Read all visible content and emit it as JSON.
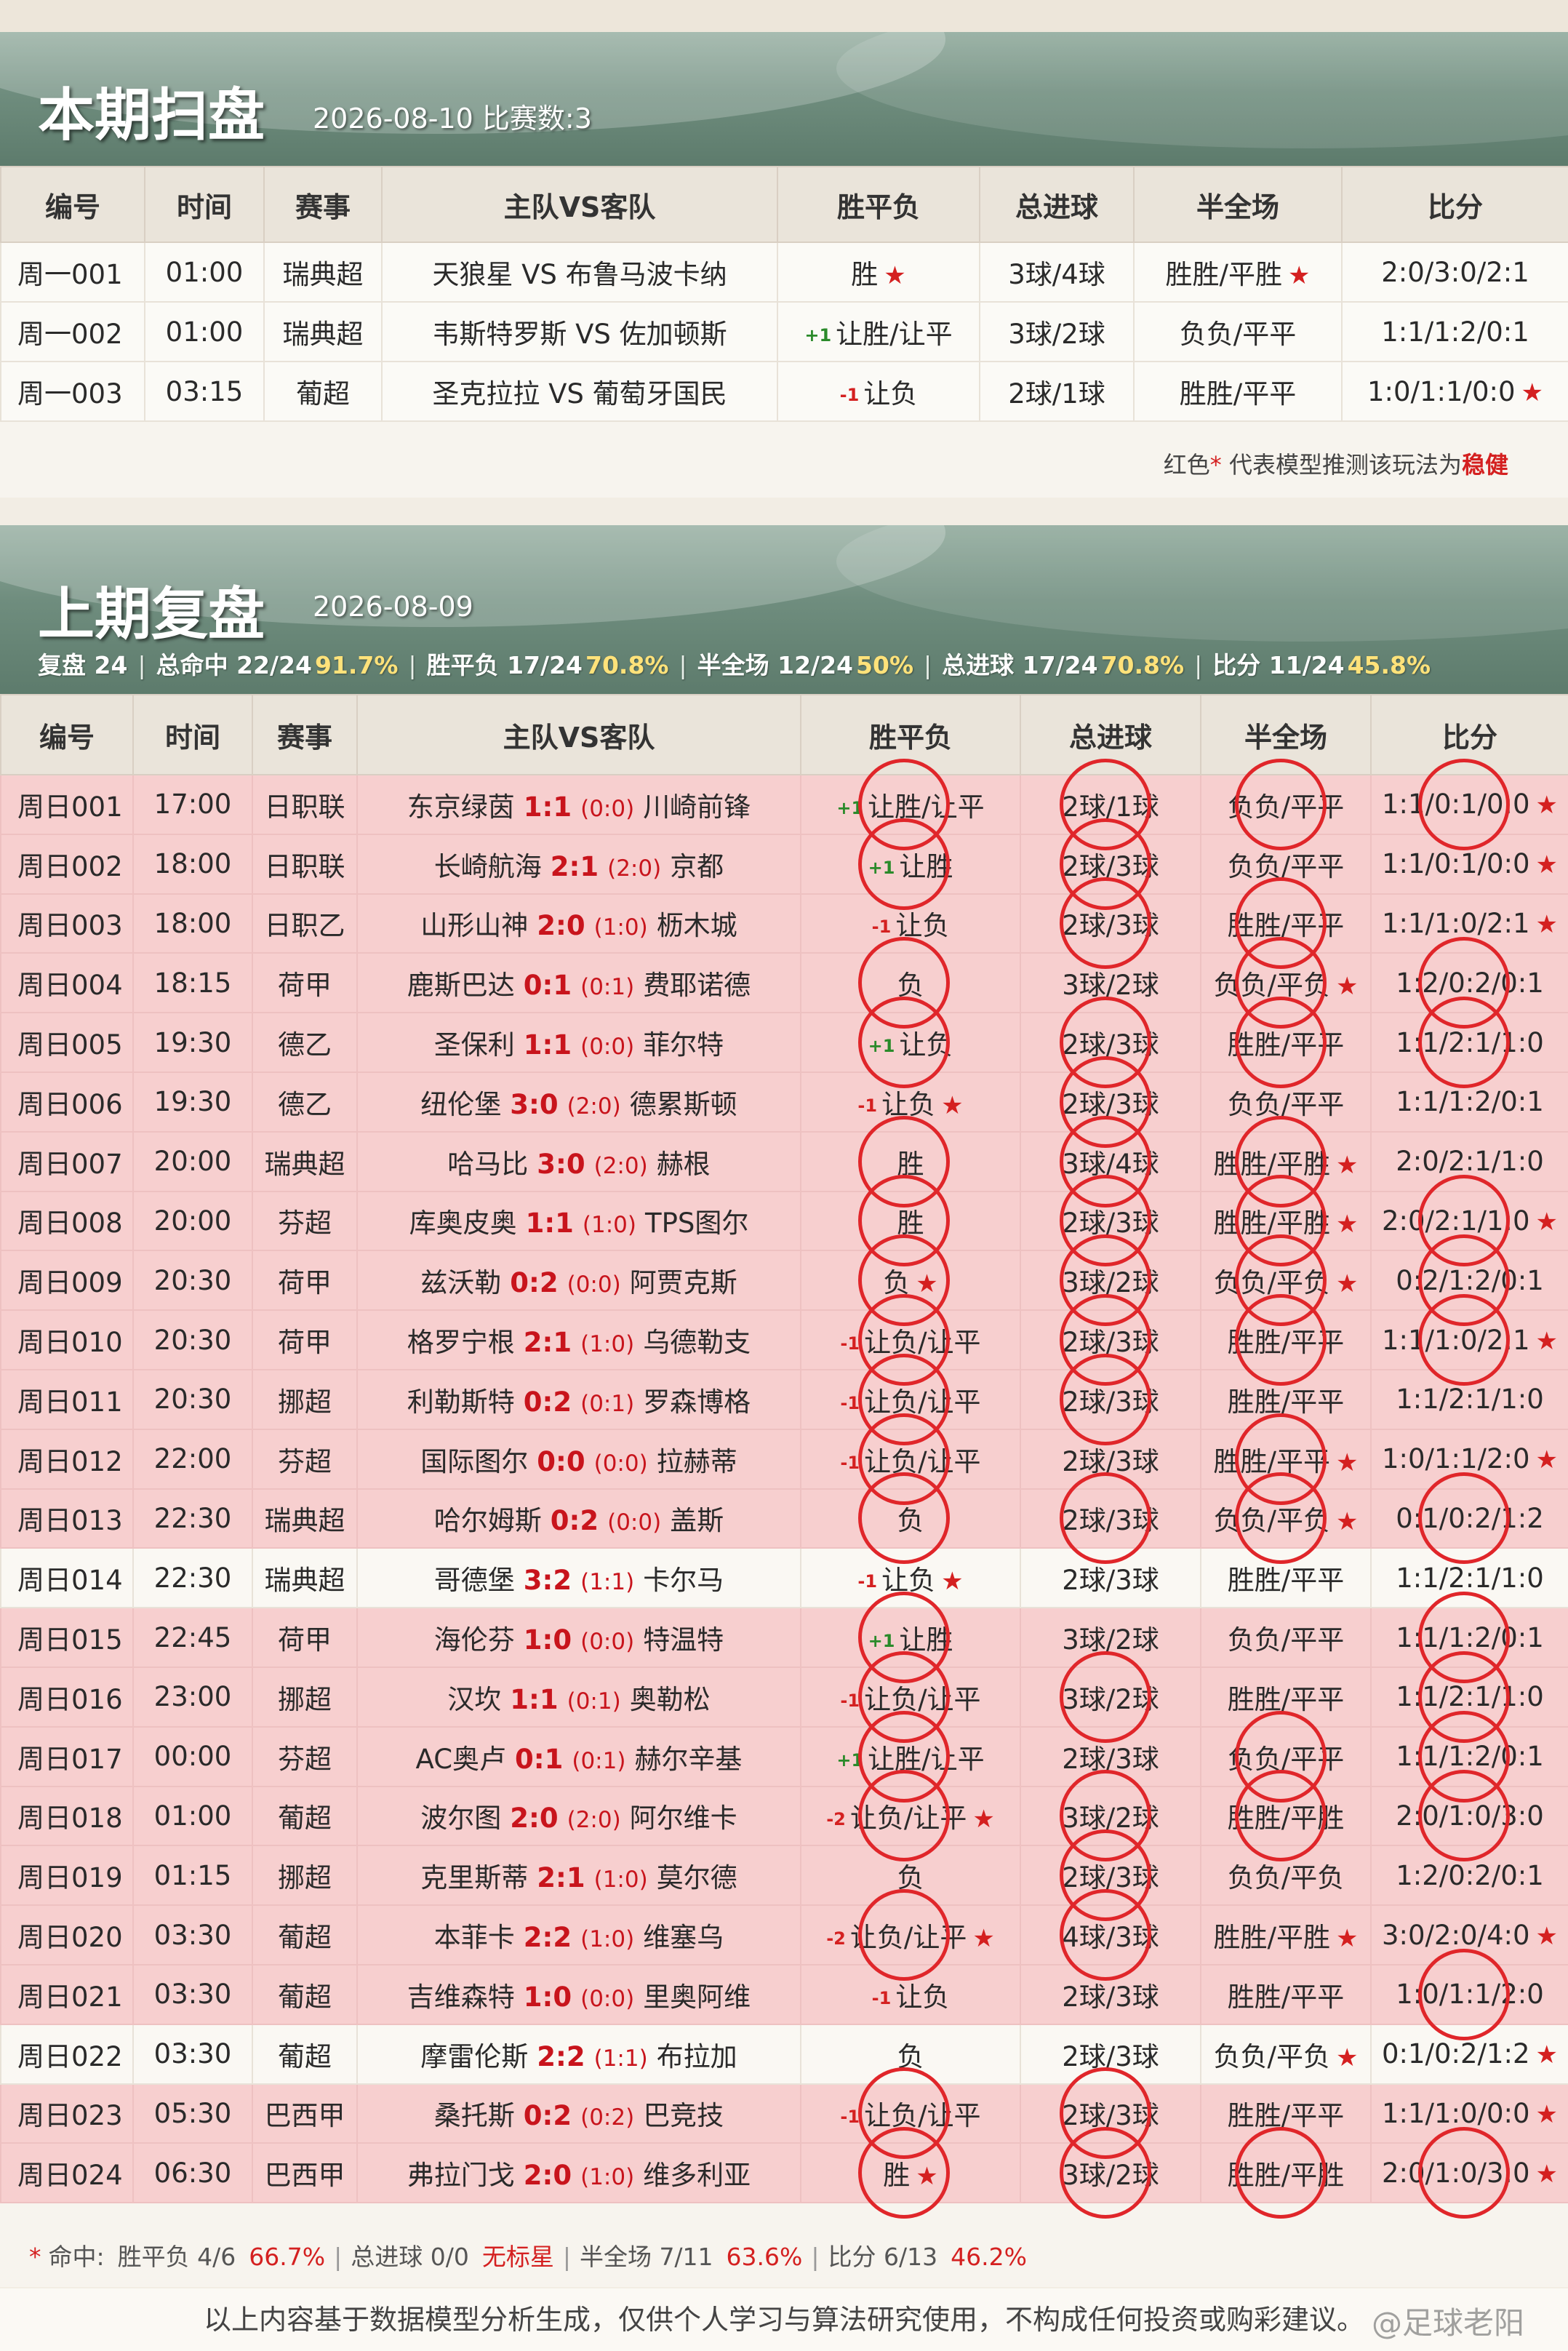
{
  "current": {
    "title": "本期扫盘",
    "subtitle": "2026-08-10 比赛数:3",
    "headers": [
      "编号",
      "时间",
      "赛事",
      "主队VS客队",
      "胜平负",
      "总进球",
      "半全场",
      "比分"
    ],
    "rows": [
      {
        "no": "周一001",
        "time": "01:00",
        "league": "瑞典超",
        "match": "天狼星 VS 布鲁马波卡纳",
        "hc": "",
        "hcClass": "",
        "spf": "胜",
        "spfStar": "★",
        "total": "3球/4球",
        "totalStar": "",
        "bqc": "胜胜/平胜",
        "bqcStar": "★",
        "score": "2:0/3:0/2:1",
        "scoreStar": ""
      },
      {
        "no": "周一002",
        "time": "01:00",
        "league": "瑞典超",
        "match": "韦斯特罗斯 VS 佐加顿斯",
        "hc": "+1",
        "hcClass": "pos",
        "spf": "让胜/让平",
        "spfStar": "",
        "total": "3球/2球",
        "totalStar": "",
        "bqc": "负负/平平",
        "bqcStar": "",
        "score": "1:1/1:2/0:1",
        "scoreStar": ""
      },
      {
        "no": "周一003",
        "time": "03:15",
        "league": "葡超",
        "match": "圣克拉拉 VS 葡萄牙国民",
        "hc": "-1",
        "hcClass": "neg",
        "spf": "让负",
        "spfStar": "",
        "total": "2球/1球",
        "totalStar": "",
        "bqc": "胜胜/平平",
        "bqcStar": "",
        "score": "1:0/1:1/0:0",
        "scoreStar": "★"
      }
    ],
    "note": {
      "pre": "红色",
      "star": "*",
      "mid": " 代表模型推测该玩法为",
      "key": "稳健"
    }
  },
  "previous": {
    "title": "上期复盘",
    "subtitle": "2026-08-09",
    "stats": [
      {
        "label": "复盘 ",
        "value": "24",
        "pct": ""
      },
      {
        "label": "总命中 ",
        "value": "22/24",
        "pct": "91.7%"
      },
      {
        "label": "胜平负 ",
        "value": "17/24",
        "pct": "70.8%"
      },
      {
        "label": "半全场 ",
        "value": "12/24",
        "pct": "50%"
      },
      {
        "label": "总进球 ",
        "value": "17/24",
        "pct": "70.8%"
      },
      {
        "label": "比分 ",
        "value": "11/24",
        "pct": "45.8%"
      }
    ],
    "headers": [
      "编号",
      "时间",
      "赛事",
      "主队VS客队",
      "胜平负",
      "总进球",
      "半全场",
      "比分"
    ],
    "rows": [
      {
        "no": "周日001",
        "time": "17:00",
        "league": "日职联",
        "home": "东京绿茵",
        "score": "1:1",
        "half": "(0:0)",
        "away": "川崎前锋",
        "hc": "+1",
        "hcClass": "pos",
        "spf": "让胜/让平",
        "spfStar": "",
        "total": "2球/1球",
        "totalStar": "",
        "bqc": "负负/平平",
        "bqcStar": "",
        "cs": "1:1/0:1/0:0",
        "csStar": "★",
        "hit": true,
        "circles": [
          1,
          1,
          1,
          1
        ]
      },
      {
        "no": "周日002",
        "time": "18:00",
        "league": "日职联",
        "home": "长崎航海",
        "score": "2:1",
        "half": "(2:0)",
        "away": "京都",
        "hc": "+1",
        "hcClass": "pos",
        "spf": "让胜",
        "spfStar": "",
        "total": "2球/3球",
        "totalStar": "",
        "bqc": "负负/平平",
        "bqcStar": "",
        "cs": "1:1/0:1/0:0",
        "csStar": "★",
        "hit": true,
        "circles": [
          1,
          1,
          0,
          0
        ]
      },
      {
        "no": "周日003",
        "time": "18:00",
        "league": "日职乙",
        "home": "山形山神",
        "score": "2:0",
        "half": "(1:0)",
        "away": "枥木城",
        "hc": "-1",
        "hcClass": "neg",
        "spf": "让负",
        "spfStar": "",
        "total": "2球/3球",
        "totalStar": "",
        "bqc": "胜胜/平平",
        "bqcStar": "",
        "cs": "1:1/1:0/2:1",
        "csStar": "★",
        "hit": true,
        "circles": [
          0,
          1,
          1,
          0
        ]
      },
      {
        "no": "周日004",
        "time": "18:15",
        "league": "荷甲",
        "home": "鹿斯巴达",
        "score": "0:1",
        "half": "(0:1)",
        "away": "费耶诺德",
        "hc": "",
        "hcClass": "",
        "spf": "负",
        "spfStar": "",
        "total": "3球/2球",
        "totalStar": "",
        "bqc": "负负/平负",
        "bqcStar": "★",
        "cs": "1:2/0:2/0:1",
        "csStar": "",
        "hit": true,
        "circles": [
          1,
          0,
          1,
          1
        ]
      },
      {
        "no": "周日005",
        "time": "19:30",
        "league": "德乙",
        "home": "圣保利",
        "score": "1:1",
        "half": "(0:0)",
        "away": "菲尔特",
        "hc": "+1",
        "hcClass": "pos",
        "spf": "让负",
        "spfStar": "",
        "total": "2球/3球",
        "totalStar": "",
        "bqc": "胜胜/平平",
        "bqcStar": "",
        "cs": "1:1/2:1/1:0",
        "csStar": "",
        "hit": true,
        "circles": [
          1,
          1,
          1,
          1
        ]
      },
      {
        "no": "周日006",
        "time": "19:30",
        "league": "德乙",
        "home": "纽伦堡",
        "score": "3:0",
        "half": "(2:0)",
        "away": "德累斯顿",
        "hc": "-1",
        "hcClass": "neg",
        "spf": "让负",
        "spfStar": "★",
        "total": "2球/3球",
        "totalStar": "",
        "bqc": "负负/平平",
        "bqcStar": "",
        "cs": "1:1/1:2/0:1",
        "csStar": "",
        "hit": true,
        "circles": [
          0,
          1,
          0,
          0
        ]
      },
      {
        "no": "周日007",
        "time": "20:00",
        "league": "瑞典超",
        "home": "哈马比",
        "score": "3:0",
        "half": "(2:0)",
        "away": "赫根",
        "hc": "",
        "hcClass": "",
        "spf": "胜",
        "spfStar": "",
        "total": "3球/4球",
        "totalStar": "",
        "bqc": "胜胜/平胜",
        "bqcStar": "★",
        "cs": "2:0/2:1/1:0",
        "csStar": "",
        "hit": true,
        "circles": [
          1,
          1,
          1,
          0
        ]
      },
      {
        "no": "周日008",
        "time": "20:00",
        "league": "芬超",
        "home": "库奥皮奥",
        "score": "1:1",
        "half": "(1:0)",
        "away": "TPS图尔",
        "hc": "",
        "hcClass": "",
        "spf": "胜",
        "spfStar": "",
        "total": "2球/3球",
        "totalStar": "",
        "bqc": "胜胜/平胜",
        "bqcStar": "★",
        "cs": "2:0/2:1/1:0",
        "csStar": "★",
        "hit": true,
        "circles": [
          1,
          1,
          1,
          1
        ]
      },
      {
        "no": "周日009",
        "time": "20:30",
        "league": "荷甲",
        "home": "兹沃勒",
        "score": "0:2",
        "half": "(0:0)",
        "away": "阿贾克斯",
        "hc": "",
        "hcClass": "",
        "spf": "负",
        "spfStar": "★",
        "total": "3球/2球",
        "totalStar": "",
        "bqc": "负负/平负",
        "bqcStar": "★",
        "cs": "0:2/1:2/0:1",
        "csStar": "",
        "hit": true,
        "circles": [
          1,
          1,
          1,
          1
        ]
      },
      {
        "no": "周日010",
        "time": "20:30",
        "league": "荷甲",
        "home": "格罗宁根",
        "score": "2:1",
        "half": "(1:0)",
        "away": "乌德勒支",
        "hc": "-1",
        "hcClass": "neg",
        "spf": "让负/让平",
        "spfStar": "",
        "total": "2球/3球",
        "totalStar": "",
        "bqc": "胜胜/平平",
        "bqcStar": "",
        "cs": "1:1/1:0/2:1",
        "csStar": "★",
        "hit": true,
        "circles": [
          1,
          1,
          1,
          1
        ]
      },
      {
        "no": "周日011",
        "time": "20:30",
        "league": "挪超",
        "home": "利勒斯特",
        "score": "0:2",
        "half": "(0:1)",
        "away": "罗森博格",
        "hc": "-1",
        "hcClass": "neg",
        "spf": "让负/让平",
        "spfStar": "",
        "total": "2球/3球",
        "totalStar": "",
        "bqc": "胜胜/平平",
        "bqcStar": "",
        "cs": "1:1/2:1/1:0",
        "csStar": "",
        "hit": true,
        "circles": [
          1,
          1,
          0,
          0
        ]
      },
      {
        "no": "周日012",
        "time": "22:00",
        "league": "芬超",
        "home": "国际图尔",
        "score": "0:0",
        "half": "(0:0)",
        "away": "拉赫蒂",
        "hc": "-1",
        "hcClass": "neg",
        "spf": "让负/让平",
        "spfStar": "",
        "total": "2球/3球",
        "totalStar": "",
        "bqc": "胜胜/平平",
        "bqcStar": "★",
        "cs": "1:0/1:1/2:0",
        "csStar": "★",
        "hit": true,
        "circles": [
          1,
          0,
          1,
          0
        ]
      },
      {
        "no": "周日013",
        "time": "22:30",
        "league": "瑞典超",
        "home": "哈尔姆斯",
        "score": "0:2",
        "half": "(0:0)",
        "away": "盖斯",
        "hc": "",
        "hcClass": "",
        "spf": "负",
        "spfStar": "",
        "total": "2球/3球",
        "totalStar": "",
        "bqc": "负负/平负",
        "bqcStar": "★",
        "cs": "0:1/0:2/1:2",
        "csStar": "",
        "hit": true,
        "circles": [
          1,
          1,
          1,
          1
        ]
      },
      {
        "no": "周日014",
        "time": "22:30",
        "league": "瑞典超",
        "home": "哥德堡",
        "score": "3:2",
        "half": "(1:1)",
        "away": "卡尔马",
        "hc": "-1",
        "hcClass": "neg",
        "spf": "让负",
        "spfStar": "★",
        "total": "2球/3球",
        "totalStar": "",
        "bqc": "胜胜/平平",
        "bqcStar": "",
        "cs": "1:1/2:1/1:0",
        "csStar": "",
        "hit": false,
        "circles": [
          0,
          0,
          0,
          0
        ]
      },
      {
        "no": "周日015",
        "time": "22:45",
        "league": "荷甲",
        "home": "海伦芬",
        "score": "1:0",
        "half": "(0:0)",
        "away": "特温特",
        "hc": "+1",
        "hcClass": "pos",
        "spf": "让胜",
        "spfStar": "",
        "total": "3球/2球",
        "totalStar": "",
        "bqc": "负负/平平",
        "bqcStar": "",
        "cs": "1:1/1:2/0:1",
        "csStar": "",
        "hit": true,
        "circles": [
          1,
          0,
          0,
          1
        ]
      },
      {
        "no": "周日016",
        "time": "23:00",
        "league": "挪超",
        "home": "汉坎",
        "score": "1:1",
        "half": "(0:1)",
        "away": "奥勒松",
        "hc": "-1",
        "hcClass": "neg",
        "spf": "让负/让平",
        "spfStar": "",
        "total": "3球/2球",
        "totalStar": "",
        "bqc": "胜胜/平平",
        "bqcStar": "",
        "cs": "1:1/2:1/1:0",
        "csStar": "",
        "hit": true,
        "circles": [
          1,
          1,
          0,
          1
        ]
      },
      {
        "no": "周日017",
        "time": "00:00",
        "league": "芬超",
        "home": "AC奥卢",
        "score": "0:1",
        "half": "(0:1)",
        "away": "赫尔辛基",
        "hc": "+1",
        "hcClass": "pos",
        "spf": "让胜/让平",
        "spfStar": "",
        "total": "2球/3球",
        "totalStar": "",
        "bqc": "负负/平平",
        "bqcStar": "",
        "cs": "1:1/1:2/0:1",
        "csStar": "",
        "hit": true,
        "circles": [
          1,
          0,
          1,
          1
        ]
      },
      {
        "no": "周日018",
        "time": "01:00",
        "league": "葡超",
        "home": "波尔图",
        "score": "2:0",
        "half": "(2:0)",
        "away": "阿尔维卡",
        "hc": "-2",
        "hcClass": "neg",
        "spf": "让负/让平",
        "spfStar": "★",
        "total": "3球/2球",
        "totalStar": "",
        "bqc": "胜胜/平胜",
        "bqcStar": "",
        "cs": "2:0/1:0/3:0",
        "csStar": "",
        "hit": true,
        "circles": [
          1,
          1,
          1,
          1
        ]
      },
      {
        "no": "周日019",
        "time": "01:15",
        "league": "挪超",
        "home": "克里斯蒂",
        "score": "2:1",
        "half": "(1:0)",
        "away": "莫尔德",
        "hc": "",
        "hcClass": "",
        "spf": "负",
        "spfStar": "",
        "total": "2球/3球",
        "totalStar": "",
        "bqc": "负负/平负",
        "bqcStar": "",
        "cs": "1:2/0:2/0:1",
        "csStar": "",
        "hit": true,
        "circles": [
          0,
          1,
          0,
          0
        ]
      },
      {
        "no": "周日020",
        "time": "03:30",
        "league": "葡超",
        "home": "本菲卡",
        "score": "2:2",
        "half": "(1:0)",
        "away": "维塞乌",
        "hc": "-2",
        "hcClass": "neg",
        "spf": "让负/让平",
        "spfStar": "★",
        "total": "4球/3球",
        "totalStar": "",
        "bqc": "胜胜/平胜",
        "bqcStar": "★",
        "cs": "3:0/2:0/4:0",
        "csStar": "★",
        "hit": true,
        "circles": [
          1,
          1,
          0,
          0
        ]
      },
      {
        "no": "周日021",
        "time": "03:30",
        "league": "葡超",
        "home": "吉维森特",
        "score": "1:0",
        "half": "(0:0)",
        "away": "里奥阿维",
        "hc": "-1",
        "hcClass": "neg",
        "spf": "让负",
        "spfStar": "",
        "total": "2球/3球",
        "totalStar": "",
        "bqc": "胜胜/平平",
        "bqcStar": "",
        "cs": "1:0/1:1/2:0",
        "csStar": "",
        "hit": true,
        "circles": [
          0,
          0,
          0,
          1
        ]
      },
      {
        "no": "周日022",
        "time": "03:30",
        "league": "葡超",
        "home": "摩雷伦斯",
        "score": "2:2",
        "half": "(1:1)",
        "away": "布拉加",
        "hc": "",
        "hcClass": "",
        "spf": "负",
        "spfStar": "",
        "total": "2球/3球",
        "totalStar": "",
        "bqc": "负负/平负",
        "bqcStar": "★",
        "cs": "0:1/0:2/1:2",
        "csStar": "★",
        "hit": false,
        "circles": [
          0,
          0,
          0,
          0
        ]
      },
      {
        "no": "周日023",
        "time": "05:30",
        "league": "巴西甲",
        "home": "桑托斯",
        "score": "0:2",
        "half": "(0:2)",
        "away": "巴竞技",
        "hc": "-1",
        "hcClass": "neg",
        "spf": "让负/让平",
        "spfStar": "",
        "total": "2球/3球",
        "totalStar": "",
        "bqc": "胜胜/平平",
        "bqcStar": "",
        "cs": "1:1/1:0/0:0",
        "csStar": "★",
        "hit": true,
        "circles": [
          1,
          1,
          0,
          0
        ]
      },
      {
        "no": "周日024",
        "time": "06:30",
        "league": "巴西甲",
        "home": "弗拉门戈",
        "score": "2:0",
        "half": "(1:0)",
        "away": "维多利亚",
        "hc": "",
        "hcClass": "",
        "spf": "胜",
        "spfStar": "★",
        "total": "3球/2球",
        "totalStar": "",
        "bqc": "胜胜/平胜",
        "bqcStar": "",
        "cs": "2:0/1:0/3:0",
        "csStar": "★",
        "hit": true,
        "circles": [
          1,
          1,
          1,
          1
        ]
      }
    ],
    "summary": [
      {
        "label": "胜平负 ",
        "value": "4/6",
        "pct": "66.7%"
      },
      {
        "label": "总进球 ",
        "value": "0/0",
        "pct": "无标星"
      },
      {
        "label": "半全场 ",
        "value": "7/11",
        "pct": "63.6%"
      },
      {
        "label": "比分 ",
        "value": "6/13",
        "pct": "46.2%"
      }
    ],
    "summaryPrefix": "命中:",
    "summaryStar": "*"
  },
  "disclaimer": "以上内容基于数据模型分析生成，仅供个人学习与算法研究使用，不构成任何投资或购彩建议。",
  "watermark": "@足球老阳",
  "colors": {
    "accent": "#d42020",
    "banner": "#6f8d7e",
    "hitRow": "#f7cfcf",
    "circle": "#e0262a"
  }
}
